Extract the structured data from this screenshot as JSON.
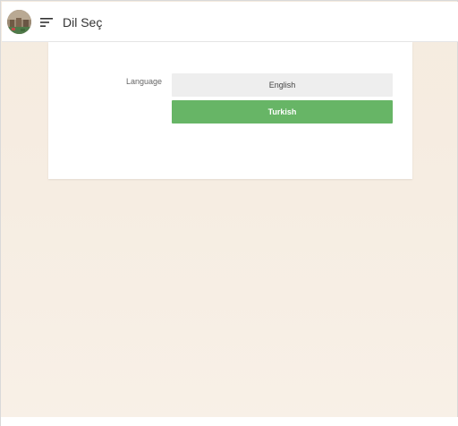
{
  "header": {
    "title": "Dil Seç",
    "avatar_icon": "avatar-icon",
    "menu_icon": "menu-icon"
  },
  "form": {
    "language_label": "Language",
    "options": [
      {
        "label": "English",
        "selected": false
      },
      {
        "label": "Turkish",
        "selected": true
      }
    ]
  },
  "colors": {
    "accent": "#67b566",
    "background": "#f5ebdf",
    "option_default": "#eeeeee"
  }
}
